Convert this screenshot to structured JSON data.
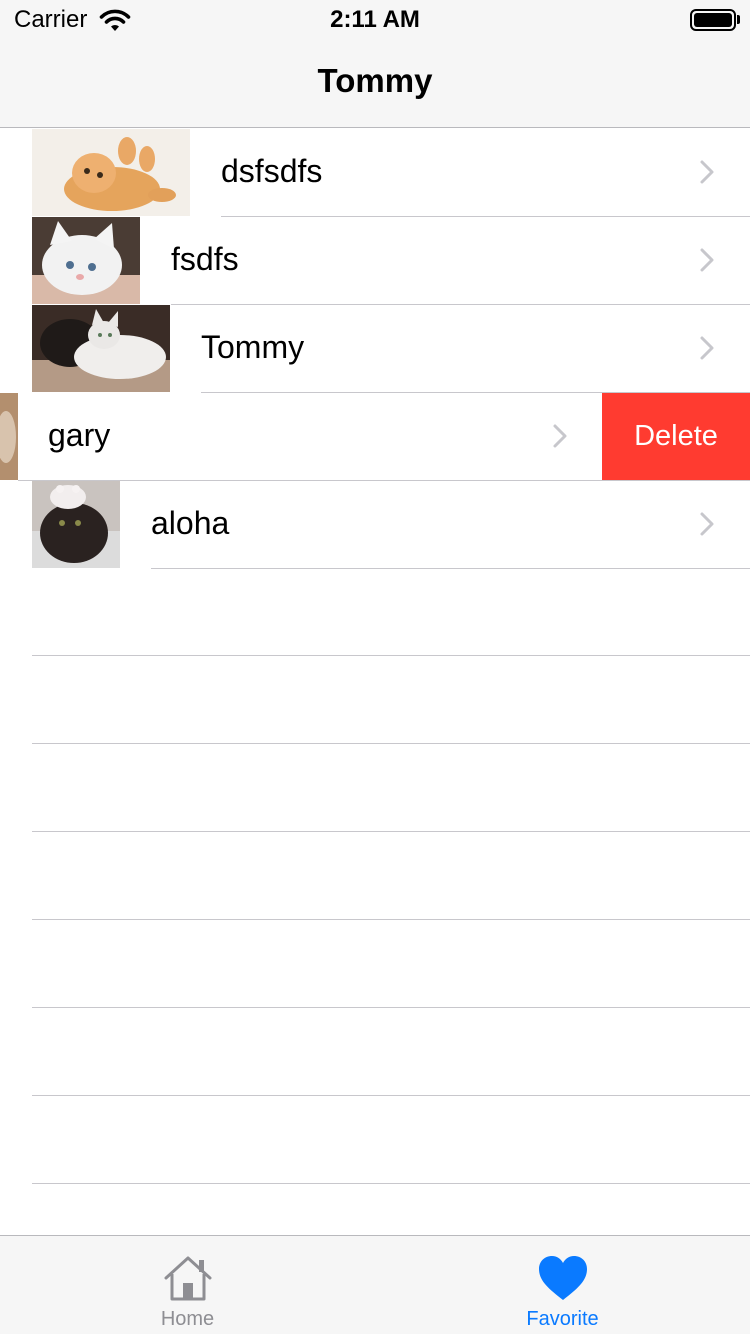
{
  "status_bar": {
    "carrier": "Carrier",
    "time": "2:11 AM"
  },
  "nav": {
    "title": "Tommy"
  },
  "rows": [
    {
      "label": "dsfsdfs"
    },
    {
      "label": "fsdfs"
    },
    {
      "label": "Tommy"
    },
    {
      "label": "gary",
      "delete_label": "Delete"
    },
    {
      "label": "aloha"
    }
  ],
  "tabs": [
    {
      "label": "Home",
      "icon": "house-icon",
      "selected": false
    },
    {
      "label": "Favorite",
      "icon": "heart-icon",
      "selected": true
    }
  ],
  "colors": {
    "accent": "#0a7aff",
    "delete": "#ff3b30",
    "tab_inactive": "#8e8e93",
    "chevron": "#c7c7cc"
  }
}
